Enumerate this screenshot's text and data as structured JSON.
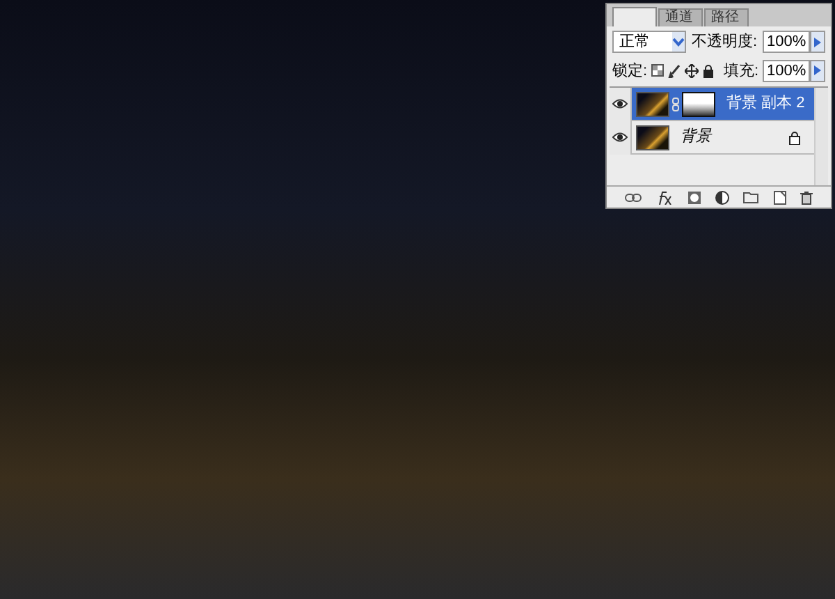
{
  "layers_panel": {
    "tabs": [
      {
        "selected": true
      },
      {
        "label": "通道",
        "selected": false
      },
      {
        "label": "路径",
        "selected": false
      }
    ],
    "blend_mode": "正常",
    "opacity_label": "不透明度:",
    "opacity_value": "100%",
    "lock_label": "锁定:",
    "fill_label": "填充:",
    "fill_value": "100%",
    "layers": [
      {
        "name": "背景 副本 2",
        "selected": true,
        "visible": true,
        "locked": false,
        "has_mask": true
      },
      {
        "name": "背景",
        "selected": false,
        "visible": true,
        "locked": true,
        "has_mask": false
      }
    ]
  }
}
